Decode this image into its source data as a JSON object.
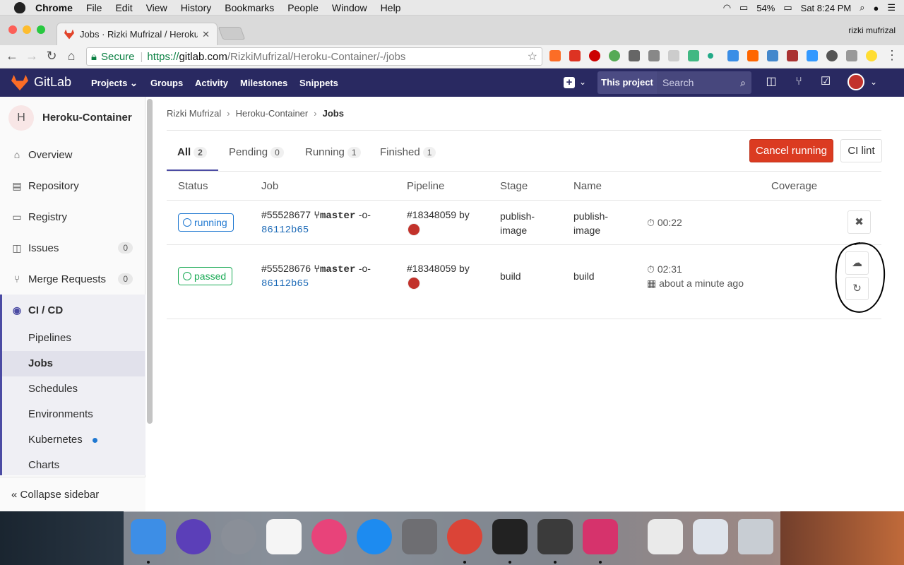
{
  "menubar": {
    "app": "Chrome",
    "items": [
      "File",
      "Edit",
      "View",
      "History",
      "Bookmarks",
      "People",
      "Window",
      "Help"
    ],
    "battery": "54%",
    "clock": "Sat 8:24 PM"
  },
  "browser": {
    "tab_title": "Jobs · Rizki Mufrizal / Heroku-",
    "profile": "rizki mufrizal",
    "secure_label": "Secure",
    "url_scheme": "https://",
    "url_host": "gitlab.com",
    "url_path": "/RizkiMufrizal/Heroku-Container/-/jobs"
  },
  "gitlab": {
    "brand": "GitLab",
    "nav": [
      "Projects",
      "Groups",
      "Activity",
      "Milestones",
      "Snippets"
    ],
    "this_project": "This project",
    "search_placeholder": "Search"
  },
  "sidebar": {
    "project_initial": "H",
    "project_name": "Heroku-Container",
    "items": [
      {
        "label": "Overview",
        "count": null
      },
      {
        "label": "Repository",
        "count": null
      },
      {
        "label": "Registry",
        "count": null
      },
      {
        "label": "Issues",
        "count": "0"
      },
      {
        "label": "Merge Requests",
        "count": "0"
      },
      {
        "label": "CI / CD",
        "count": null
      }
    ],
    "sub": [
      "Pipelines",
      "Jobs",
      "Schedules",
      "Environments",
      "Kubernetes",
      "Charts"
    ],
    "collapse": "Collapse sidebar"
  },
  "breadcrumb": {
    "owner": "Rizki Mufrizal",
    "project": "Heroku-Container",
    "page": "Jobs"
  },
  "tabs": [
    {
      "label": "All",
      "count": "2"
    },
    {
      "label": "Pending",
      "count": "0"
    },
    {
      "label": "Running",
      "count": "1"
    },
    {
      "label": "Finished",
      "count": "1"
    }
  ],
  "buttons": {
    "cancel_running": "Cancel running",
    "ci_lint": "CI lint"
  },
  "columns": [
    "Status",
    "Job",
    "Pipeline",
    "Stage",
    "Name",
    "Coverage"
  ],
  "jobs": [
    {
      "status": "running",
      "job": "#55528677",
      "branch": "master",
      "sha": "86112b65",
      "pipeline": "#18348059 by",
      "stage": "publish-image",
      "name": "publish-image",
      "duration": "00:22",
      "finished": ""
    },
    {
      "status": "passed",
      "job": "#55528676",
      "branch": "master",
      "sha": "86112b65",
      "pipeline": "#18348059 by",
      "stage": "build",
      "name": "build",
      "duration": "02:31",
      "finished": "about a minute ago"
    }
  ],
  "colors": {
    "header": "#292961",
    "accent": "#4b4ba3",
    "danger": "#db3b21",
    "running": "#1f78d1",
    "passed": "#1aaa55"
  }
}
